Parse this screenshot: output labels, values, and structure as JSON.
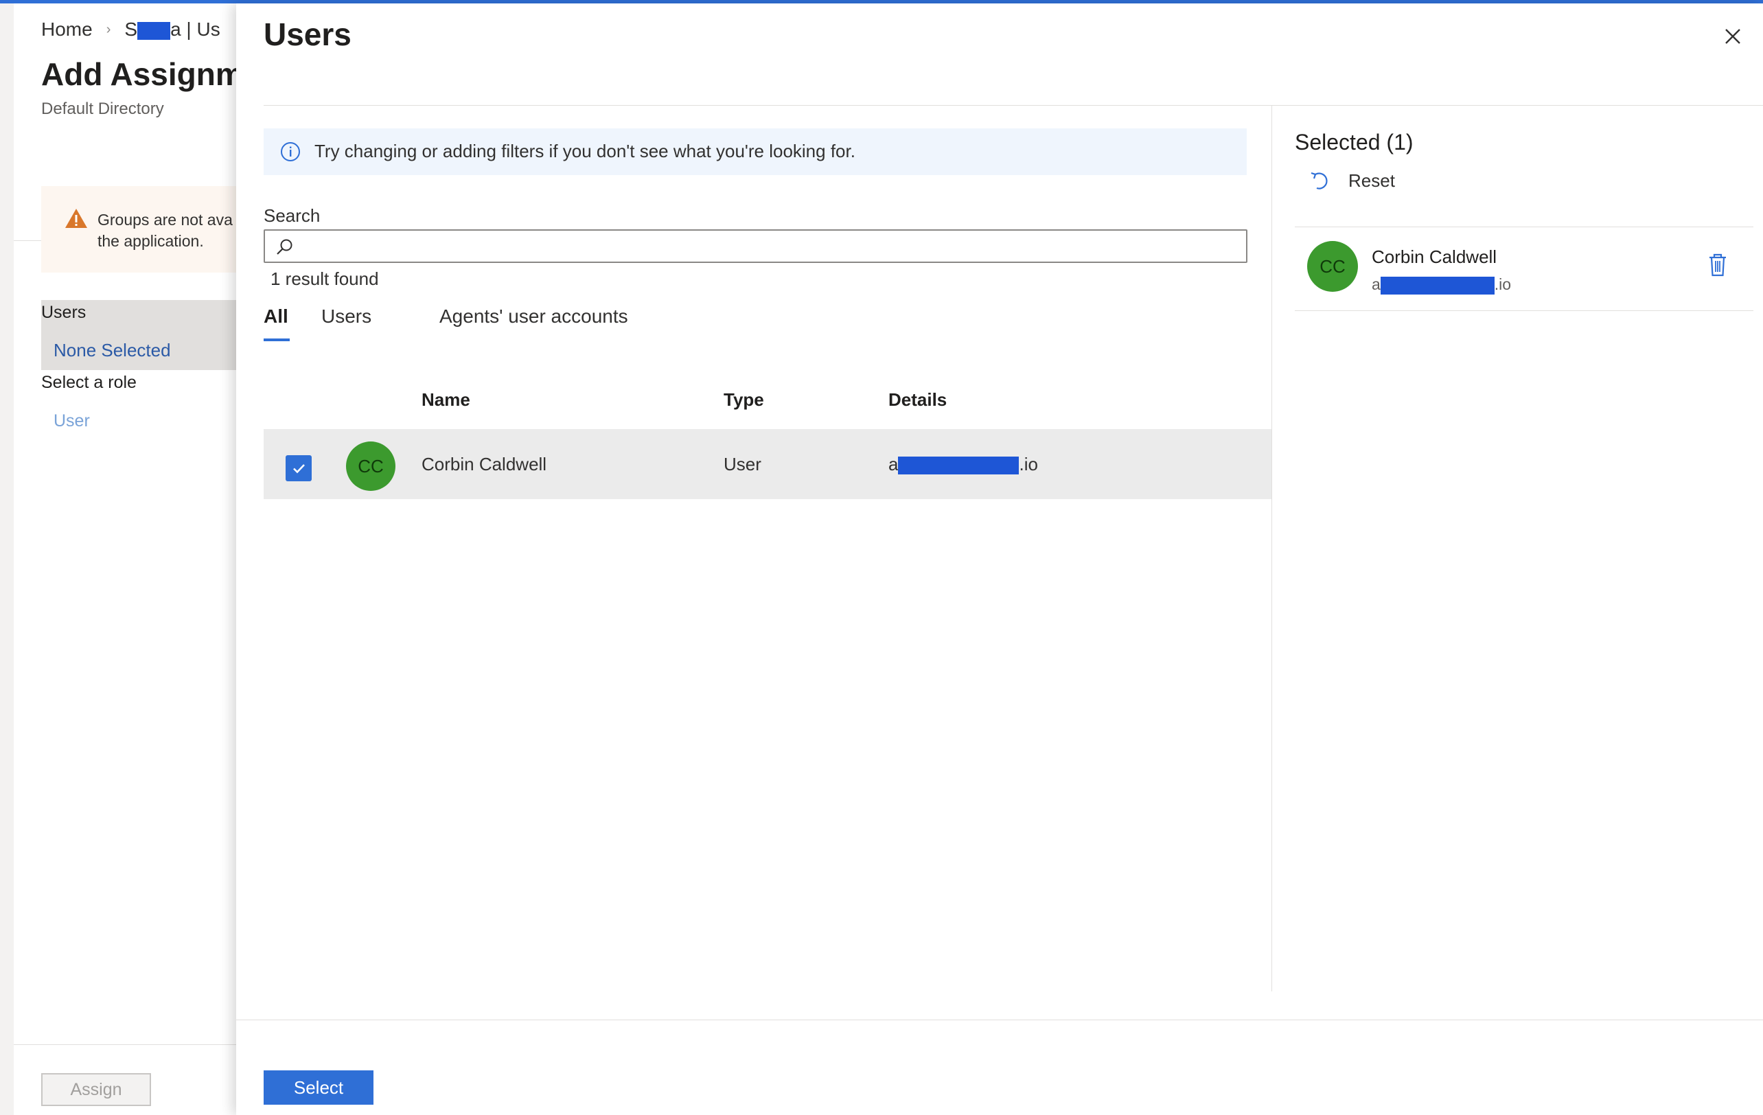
{
  "background": {
    "breadcrumb": {
      "home": "Home",
      "app_prefix": "S",
      "app_suffix": "a | Us"
    },
    "title": "Add Assignm",
    "subtitle": "Default Directory",
    "warning": {
      "line1": "Groups are not ava",
      "line2": "the application."
    },
    "users_section": {
      "label": "Users",
      "value": "None Selected"
    },
    "role_section": {
      "label": "Select a role",
      "value": "User"
    },
    "assign_label": "Assign"
  },
  "panel": {
    "title": "Users",
    "info_text": "Try changing or adding filters if you don't see what you're looking for.",
    "search": {
      "label": "Search",
      "value": "",
      "placeholder": ""
    },
    "result_count": "1 result found",
    "tabs": [
      {
        "label": "All",
        "active": true
      },
      {
        "label": "Users",
        "active": false
      },
      {
        "label": "Agents' user accounts",
        "active": false
      }
    ],
    "table": {
      "columns": [
        "Name",
        "Type",
        "Details"
      ],
      "rows": [
        {
          "initials": "CC",
          "name": "Corbin Caldwell",
          "type": "User",
          "details_prefix": "a",
          "details_suffix": ".io",
          "checked": true
        }
      ]
    },
    "selected": {
      "title": "Selected (1)",
      "reset_label": "Reset",
      "items": [
        {
          "initials": "CC",
          "name": "Corbin Caldwell",
          "email_prefix": "a",
          "email_suffix": ".io"
        }
      ]
    },
    "select_label": "Select"
  },
  "colors": {
    "accent": "#2f6fd6",
    "avatar": "#3c9a2e",
    "warning_icon": "#d9772b",
    "redaction": "#1e56d6"
  },
  "icons": [
    "chevron-right-icon",
    "warning-icon",
    "info-icon",
    "search-icon",
    "close-icon",
    "checkmark-icon",
    "reset-icon",
    "trash-icon"
  ]
}
